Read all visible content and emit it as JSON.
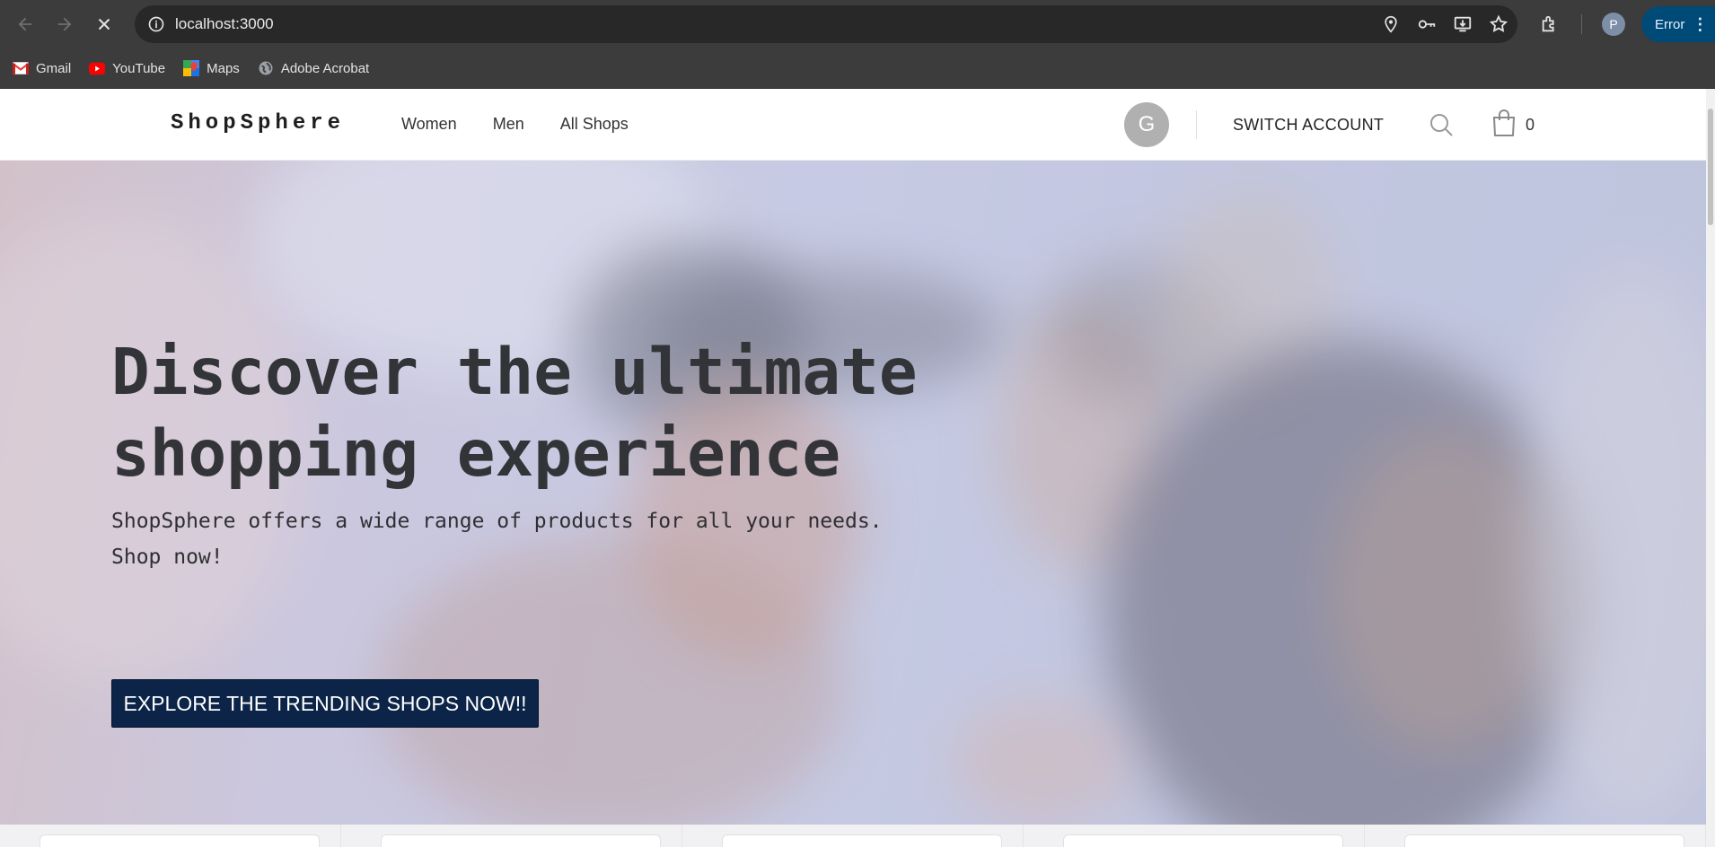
{
  "browser": {
    "url": "localhost:3000",
    "profile_initial": "P",
    "error_label": "Error",
    "bookmarks": [
      {
        "label": "Gmail",
        "icon": "gmail-icon"
      },
      {
        "label": "YouTube",
        "icon": "youtube-icon"
      },
      {
        "label": "Maps",
        "icon": "maps-icon"
      },
      {
        "label": "Adobe Acrobat",
        "icon": "globe-icon"
      }
    ]
  },
  "header": {
    "logo": "ShopSphere",
    "nav": [
      "Women",
      "Men",
      "All Shops"
    ],
    "avatar_initial": "G",
    "switch_account": "SWITCH ACCOUNT",
    "cart_count": "0"
  },
  "hero": {
    "title": "Discover the ultimate shopping experience",
    "subtitle": "ShopSphere offers a wide range of products for all your needs. Shop now!",
    "cta": "EXPLORE THE TRENDING SHOPS NOW!!"
  },
  "colors": {
    "cta_bg": "#0b2447",
    "chrome_bg": "#3c3c3c",
    "omnibox_bg": "#282828"
  }
}
